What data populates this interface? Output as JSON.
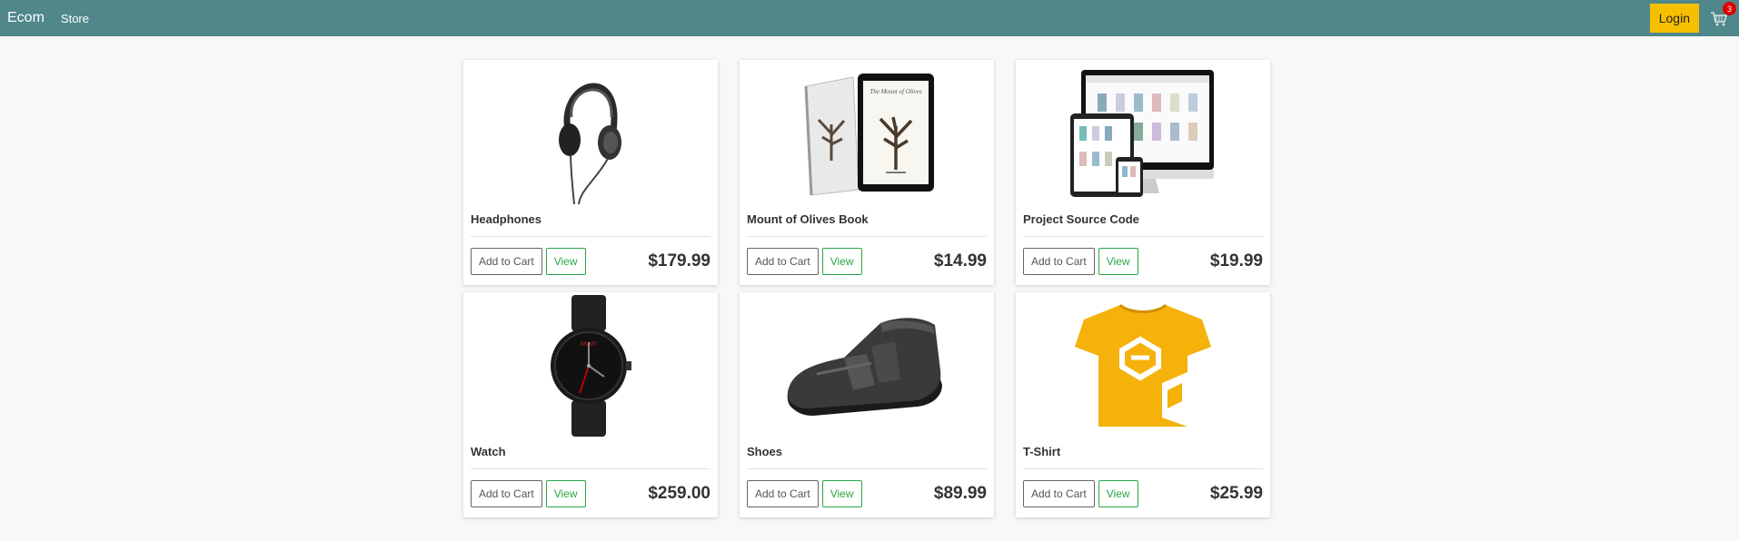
{
  "nav": {
    "brand": "Ecom",
    "store_link": "Store",
    "login_label": "Login",
    "cart_count": "3",
    "cart_icon": "cart-icon"
  },
  "colors": {
    "navbar": "#4f878b",
    "login": "#f6c000",
    "badge": "#e00000",
    "view": "#28a745"
  },
  "products": [
    {
      "name": "Headphones",
      "price": "$179.99",
      "add_label": "Add to Cart",
      "view_label": "View",
      "image": "headphones-image"
    },
    {
      "name": "Mount of Olives Book",
      "price": "$14.99",
      "add_label": "Add to Cart",
      "view_label": "View",
      "image": "book-image"
    },
    {
      "name": "Project Source Code",
      "price": "$19.99",
      "add_label": "Add to Cart",
      "view_label": "View",
      "image": "source-code-image"
    },
    {
      "name": "Watch",
      "price": "$259.00",
      "add_label": "Add to Cart",
      "view_label": "View",
      "image": "watch-image"
    },
    {
      "name": "Shoes",
      "price": "$89.99",
      "add_label": "Add to Cart",
      "view_label": "View",
      "image": "shoes-image"
    },
    {
      "name": "T-Shirt",
      "price": "$25.99",
      "add_label": "Add to Cart",
      "view_label": "View",
      "image": "tshirt-image"
    }
  ]
}
